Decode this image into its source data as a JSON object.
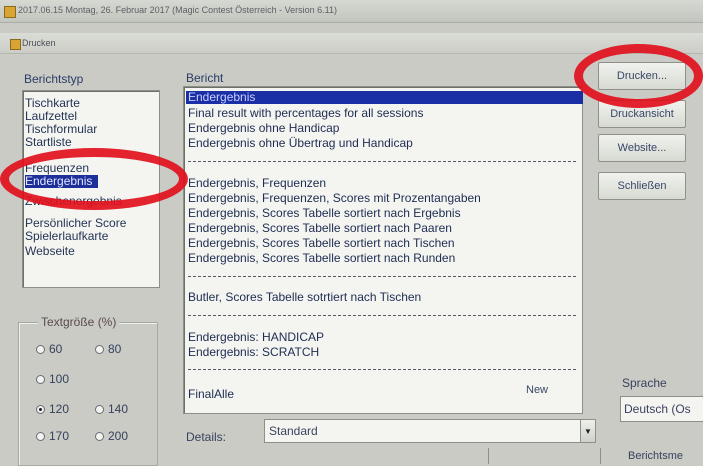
{
  "window": {
    "title": "2017.06.15 Montag, 26. Februar 2017 (Magic Contest Österreich - Version 6.11)"
  },
  "dialog": {
    "title": "Drucken"
  },
  "berichtstyp": {
    "label": "Berichtstyp",
    "items": [
      "Tischkarte",
      "Laufzettel",
      "Tischformular",
      "Startliste",
      "Frequenzen",
      "Endergebnis",
      "Zwischenergebnis",
      "Persönlicher Score",
      "Spielerlaufkarte",
      "Webseite"
    ],
    "selected": "Endergebnis"
  },
  "bericht": {
    "label": "Bericht",
    "items": [
      "Endergebnis",
      "Final result with percentages for all sessions",
      "Endergebnis ohne Handicap",
      "Endergebnis ohne Übertrag und Handicap",
      "Endergebnis, Frequenzen",
      "Endergebnis, Frequenzen, Scores mit Prozentangaben",
      "Endergebnis, Scores Tabelle sortiert nach Ergebnis",
      "Endergebnis, Scores Tabelle sortiert nach Paaren",
      "Endergebnis, Scores Tabelle sortiert nach Tischen",
      "Endergebnis, Scores Tabelle sortiert nach Runden",
      "Butler, Scores Tabelle sotrtiert nach Tischen",
      "Endergebnis: HANDICAP",
      "Endergebnis: SCRATCH",
      "FinalAlle"
    ],
    "selected": "Endergebnis",
    "new_tag": "New"
  },
  "buttons": {
    "drucken": "Drucken...",
    "druckansicht": "Druckansicht",
    "website": "Website...",
    "schliessen": "Schließen"
  },
  "textgroesse": {
    "label": "Textgröße (%)",
    "options": [
      "60",
      "80",
      "100",
      "120",
      "140",
      "170",
      "200"
    ],
    "selected": "120"
  },
  "details": {
    "label": "Details:",
    "value": "Standard"
  },
  "sprache": {
    "label": "Sprache",
    "value": "Deutsch (Os"
  },
  "bottom_right_label": "Berichtsme",
  "highlight_color": "#e1101c",
  "selection_color": "#1c2f9a"
}
